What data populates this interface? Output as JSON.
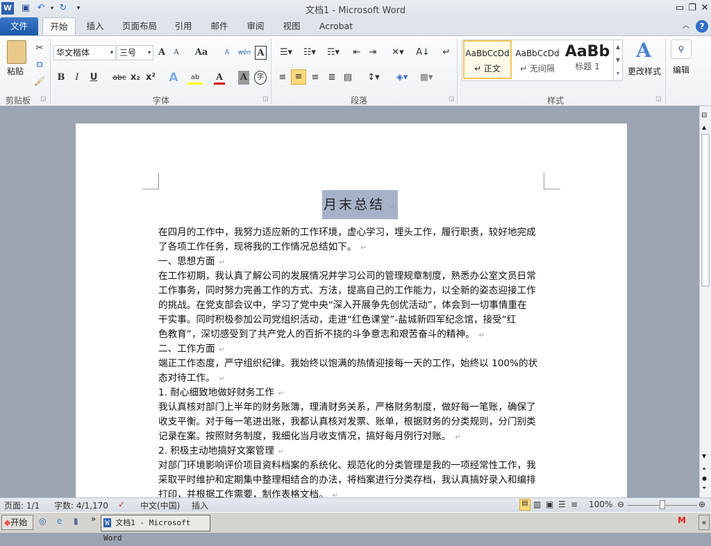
{
  "window": {
    "title": "文档1  -  Microsoft Word"
  },
  "quick_access": {
    "app_icon": "W",
    "save": "save-icon",
    "undo": "undo-icon",
    "redo": "redo-icon"
  },
  "tabs": [
    "文件",
    "开始",
    "插入",
    "页面布局",
    "引用",
    "邮件",
    "审阅",
    "视图",
    "Acrobat"
  ],
  "ribbon": {
    "clipboard": {
      "paste": "粘贴",
      "label": "剪贴板"
    },
    "font": {
      "name": "华文楷体",
      "size": "三号",
      "label": "字体",
      "bold": "B",
      "italic": "I",
      "underline": "U",
      "strike": "abc",
      "sub": "x₂",
      "sup": "x²",
      "grow": "A",
      "shrink": "A",
      "case": "Aa",
      "clear": "A",
      "phonetic": "wén",
      "border": "A",
      "shading": "A",
      "enclose": "字"
    },
    "paragraph": {
      "label": "段落"
    },
    "styles": {
      "label": "样式",
      "items": [
        {
          "preview": "AaBbCcDd",
          "name": "↵ 正文"
        },
        {
          "preview": "AaBbCcDd",
          "name": "↵ 无间隔"
        },
        {
          "preview": "AaBb",
          "name": "标题 1"
        }
      ],
      "change": "更改样式"
    },
    "editing": {
      "label": "编辑"
    }
  },
  "document": {
    "title": "月末总结",
    "lines": [
      "在四月的工作中，我努力适应新的工作环境，虚心学习，埋头工作，履行职责，较好地完成",
      "了各项工作任务，现将我的工作情况总结如下。",
      "一、思想方面",
      "在工作初期，我认真了解公司的发展情况并学习公司的管理规章制度，熟悉办公室文员日常",
      "工作事务，同时努力完善工作的方式、方法，提高自己的工作能力，以全新的姿态迎接工作",
      "的挑战。在党支部会议中，学习了党中央“深入开展争先创优活动”，体会到一切事情重在",
      "干实事。同时积极参加公司党组织活动，走进“红色课堂”-盐城新四军纪念馆，接受“红",
      "色教育”，深切感受到了共产党人的百折不挠的斗争意志和艰苦奋斗的精神。",
      "二、工作方面",
      "端正工作态度，严守组织纪律。我始终以饱满的热情迎接每一天的工作，始终以 100%的状",
      "态对待工作。",
      "1. 耐心细致地做好财务工作",
      "我认真核对部门上半年的财务账簿，理清财务关系，严格财务制度，做好每一笔账，确保了",
      "收支平衡。对于每一笔进出账，我都认真核对发票、账单，根据财务的分类规则，分门别类",
      "记录在案。按照财务制度，我细化当月收支情况，搞好每月例行对账。",
      "2. 积极主动地搞好文案管理",
      "对部门环境影响评价项目资料档案的系统化、规范化的分类管理是我的一项经常性工作，我",
      "采取平时维护和定期集中整理相结合的办法，将档案进行分类存档，我认真搞好录入和编排",
      "打印，并根据工作需要，制作表格文档。"
    ],
    "para_ends": [
      1,
      2,
      7,
      8,
      10,
      11,
      14,
      15,
      18
    ],
    "pilcrow": "↵"
  },
  "status": {
    "page": "页面: 1/1",
    "words": "字数: 4/1,170",
    "language": "中文(中国)",
    "mode": "插入",
    "zoom": "100%",
    "zoom_percent": 100
  },
  "taskbar": {
    "start": "开始",
    "window": "文档1 - Microsoft Word",
    "more": "»",
    "collapse": "«"
  }
}
